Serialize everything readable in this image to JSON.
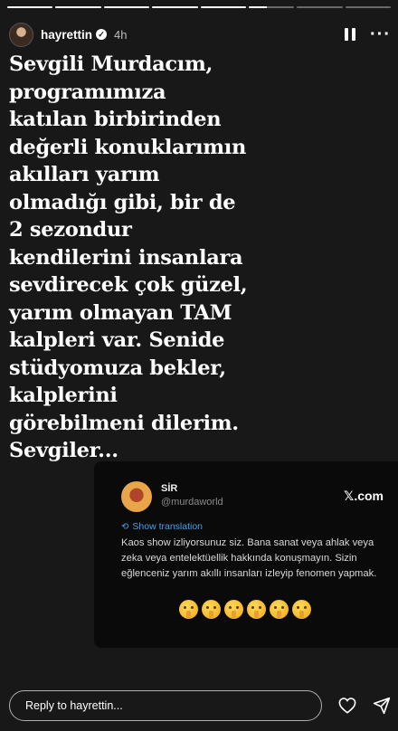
{
  "story": {
    "segments": [
      1,
      1,
      1,
      1,
      1,
      0.4,
      0,
      0
    ],
    "author": {
      "username": "hayrettin",
      "verified": true,
      "time_ago": "4h"
    },
    "text": "Sevgili Murdacım,\nprogramımıza\nkatılan birbirinden\ndeğerli konuklarımın\nakılları yarım\nolmadığı gibi, bir de\n2 sezondur\nkendilerini insanlara\nsevdirecek çok güzel,\nyarım olmayan TAM\nkalpleri var. Senide\nstüdyomuza bekler,\nkalplerini\ngörebilmeni dilerim.\nSevgiler..."
  },
  "tweet": {
    "name": "SİR",
    "handle": "@murdaworld",
    "source_x": "𝕏",
    "source_domain": ".com",
    "translate_label": "Show translation",
    "body": "Kaos show izliyorsunuz siz. Bana sanat veya ahlak veya zeka veya entelektüellik hakkında konuşmayın. Sizin eğlenceniz yarım akıllı insanları izleyip fenomen yapmak.",
    "emoji_count": 6,
    "emoji_name": "shushing-face"
  },
  "footer": {
    "reply_placeholder": "Reply to hayrettin..."
  },
  "icons": [
    "pause-icon",
    "more-icon",
    "verified-icon",
    "heart-icon",
    "send-icon",
    "translate-icon"
  ]
}
